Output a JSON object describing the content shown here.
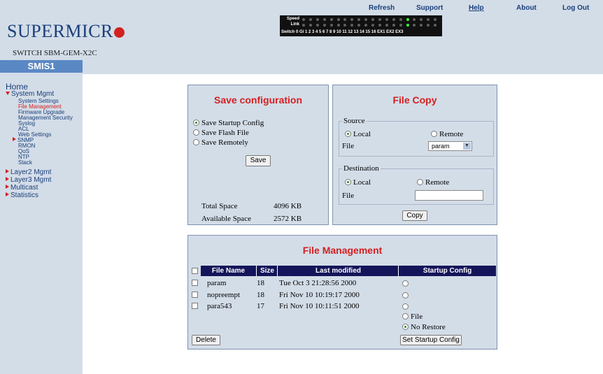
{
  "header": {
    "logo_text": "SUPERMICR",
    "switch_name": "SWITCH SBM-GEM-X2C",
    "nav": [
      "Refresh",
      "Support",
      "Help",
      "About",
      "Log Out"
    ],
    "led_panel": {
      "speed_label": "Speed",
      "link_label": "Link",
      "port_labels": "Switch 0  Gi  1  2  3  4  5  6  7  8  9  10  11  12  13  14  15  16  EX1  EX2  EX3",
      "led_on_color": "#3aff3a"
    }
  },
  "sidebar": {
    "system_name": "SMIS1",
    "home": "Home",
    "system_mgmt": "System Mgmt",
    "sub_items": [
      "System Settings",
      "File Management",
      "Firmware Upgrade",
      "Management Security",
      "Syslog",
      "ACL",
      "Web Settings",
      "SNMP",
      "RMON",
      "QoS",
      "NTP",
      "Stack"
    ],
    "active_item": "File Management",
    "top_items": [
      "Layer2 Mgmt",
      "Layer3 Mgmt",
      "Multicast",
      "Statistics"
    ]
  },
  "save_config": {
    "title": "Save configuration",
    "options": [
      "Save Startup Config",
      "Save Flash File",
      "Save Remotely"
    ],
    "selected": "Save Startup Config",
    "save_button": "Save",
    "total_space_label": "Total Space",
    "total_space_value": "4096 KB",
    "available_space_label": "Available Space",
    "available_space_value": "2572 KB"
  },
  "file_copy": {
    "title": "File Copy",
    "source_legend": "Source",
    "source_local": "Local",
    "source_remote": "Remote",
    "source_file_label": "File",
    "source_file_value": "param",
    "destination_legend": "Destination",
    "dest_local": "Local",
    "dest_remote": "Remote",
    "dest_file_label": "File",
    "dest_file_value": "",
    "copy_button": "Copy"
  },
  "file_management": {
    "title": "File Management",
    "columns": [
      "File Name",
      "Size",
      "Last modified",
      "Startup Config"
    ],
    "rows": [
      {
        "name": "param",
        "size": "18",
        "modified": "Tue Oct 3 21:28:56 2000"
      },
      {
        "name": "nopreempt",
        "size": "18",
        "modified": "Fri Nov 10 10:19:17 2000"
      },
      {
        "name": "para543",
        "size": "17",
        "modified": "Fri Nov 10 10:11:51 2000"
      }
    ],
    "extra_options": [
      "File",
      "No Restore"
    ],
    "selected_option": "No Restore",
    "delete_button": "Delete",
    "set_startup_button": "Set Startup Config"
  },
  "colors": {
    "accent_red": "#d42020",
    "brand_blue": "#1a3f7a",
    "panel_bg": "#d3dde8",
    "header_navy": "#14145a",
    "sidebar_title_bg": "#5a88c4"
  }
}
